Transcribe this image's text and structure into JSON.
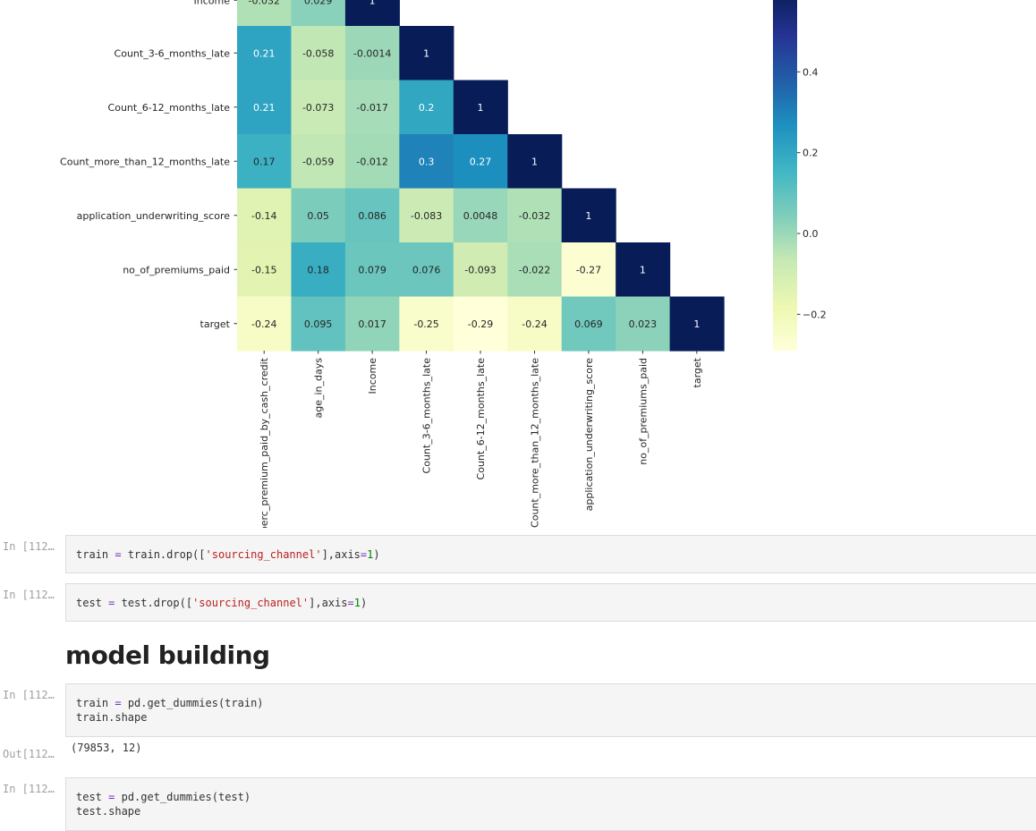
{
  "chart_data": {
    "type": "heatmap",
    "title": "",
    "colormap": "YlGnBu",
    "row_labels": [
      "Income",
      "Count_3-6_months_late",
      "Count_6-12_months_late",
      "Count_more_than_12_months_late",
      "application_underwriting_score",
      "no_of_premiums_paid",
      "target"
    ],
    "col_labels": [
      "perc_premium_paid_by_cash_credit",
      "age_in_days",
      "Income",
      "Count_3-6_months_late",
      "Count_6-12_months_late",
      "Count_more_than_12_months_late",
      "application_underwriting_score",
      "no_of_premiums_paid",
      "target"
    ],
    "values": [
      [
        -0.032,
        0.029,
        1
      ],
      [
        0.21,
        -0.058,
        -0.0014,
        1
      ],
      [
        0.21,
        -0.073,
        -0.017,
        0.2,
        1
      ],
      [
        0.17,
        -0.059,
        -0.012,
        0.3,
        0.27,
        1
      ],
      [
        -0.14,
        0.05,
        0.086,
        -0.083,
        0.0048,
        -0.032,
        1
      ],
      [
        -0.15,
        0.18,
        0.079,
        0.076,
        -0.093,
        -0.022,
        -0.27,
        1
      ],
      [
        -0.24,
        0.095,
        0.017,
        -0.25,
        -0.29,
        -0.24,
        0.069,
        0.023,
        1
      ]
    ],
    "cell_labels": [
      [
        "-0.032",
        "0.029",
        "1"
      ],
      [
        "0.21",
        "-0.058",
        "-0.0014",
        "1"
      ],
      [
        "0.21",
        "-0.073",
        "-0.017",
        "0.2",
        "1"
      ],
      [
        "0.17",
        "-0.059",
        "-0.012",
        "0.3",
        "0.27",
        "1"
      ],
      [
        "-0.14",
        "0.05",
        "0.086",
        "-0.083",
        "0.0048",
        "-0.032",
        "1"
      ],
      [
        "-0.15",
        "0.18",
        "0.079",
        "0.076",
        "-0.093",
        "-0.022",
        "-0.27",
        "1"
      ],
      [
        "-0.24",
        "0.095",
        "0.017",
        "-0.25",
        "-0.29",
        "-0.24",
        "0.069",
        "0.023",
        "1"
      ]
    ],
    "colorbar_ticks": [
      0.4,
      0.2,
      0.0,
      -0.2
    ],
    "colorbar_tick_labels": [
      "0.4",
      "0.2",
      "0.0",
      "−0.2"
    ],
    "colorbar_range": [
      -0.29,
      0.6
    ],
    "annotated": true
  },
  "cells": [
    {
      "prompt": "In [112…",
      "lines": [
        [
          {
            "t": "train",
            "c": "var"
          },
          {
            "t": " = ",
            "c": "op"
          },
          {
            "t": "train.drop([",
            "c": "var"
          },
          {
            "t": "'sourcing_channel'",
            "c": "str"
          },
          {
            "t": "],axis",
            "c": "var"
          },
          {
            "t": "=",
            "c": "op"
          },
          {
            "t": "1",
            "c": "num"
          },
          {
            "t": ")",
            "c": "var"
          }
        ]
      ]
    },
    {
      "prompt": "In [112…",
      "lines": [
        [
          {
            "t": "test",
            "c": "var"
          },
          {
            "t": " = ",
            "c": "op"
          },
          {
            "t": "test.drop([",
            "c": "var"
          },
          {
            "t": "'sourcing_channel'",
            "c": "str"
          },
          {
            "t": "],axis",
            "c": "var"
          },
          {
            "t": "=",
            "c": "op"
          },
          {
            "t": "1",
            "c": "num"
          },
          {
            "t": ")",
            "c": "var"
          }
        ]
      ]
    },
    {
      "prompt": "In [112…",
      "lines": [
        [
          {
            "t": "train",
            "c": "var"
          },
          {
            "t": " = ",
            "c": "op"
          },
          {
            "t": "pd.get_dummies(train)",
            "c": "var"
          }
        ],
        [
          {
            "t": "train.shape",
            "c": "var"
          }
        ]
      ],
      "output_prompt": "Out[112…",
      "output": "(79853, 12)"
    },
    {
      "prompt": "In [112…",
      "lines": [
        [
          {
            "t": "test",
            "c": "var"
          },
          {
            "t": " = ",
            "c": "op"
          },
          {
            "t": "pd.get_dummies(test)",
            "c": "var"
          }
        ],
        [
          {
            "t": "test.shape",
            "c": "var"
          }
        ]
      ]
    }
  ],
  "markdown": {
    "heading": "model building"
  }
}
